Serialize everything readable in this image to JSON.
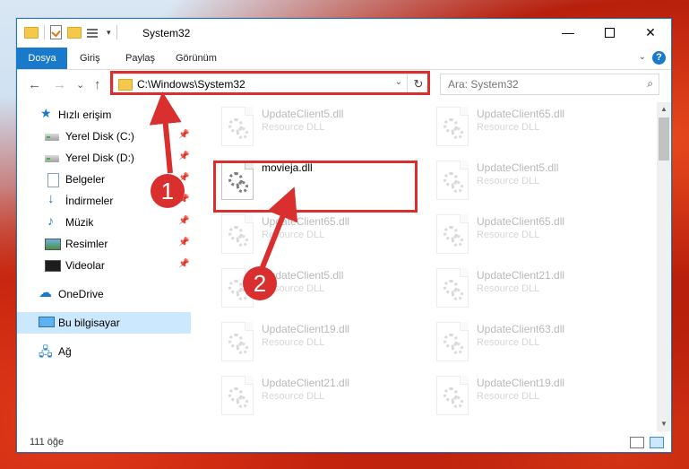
{
  "window": {
    "title": "System32",
    "controls": {
      "minimize": "—",
      "close": "✕"
    }
  },
  "ribbon": {
    "tabs": [
      "Dosya",
      "Giriş",
      "Paylaş",
      "Görünüm"
    ],
    "help": "?"
  },
  "nav": {
    "back": "←",
    "forward": "→",
    "recent": "⌄",
    "up": "↑",
    "address": "C:\\Windows\\System32",
    "refresh": "↻",
    "search_placeholder": "Ara: System32"
  },
  "sidebar": {
    "items": [
      {
        "label": "Hızlı erişim",
        "icon": "star-icon",
        "pinned": false
      },
      {
        "label": "Yerel Disk (C:)",
        "icon": "drive-icon",
        "pinned": true
      },
      {
        "label": "Yerel Disk (D:)",
        "icon": "drive-icon",
        "pinned": true
      },
      {
        "label": "Belgeler",
        "icon": "documents-icon",
        "pinned": true
      },
      {
        "label": "İndirmeler",
        "icon": "download-icon",
        "pinned": true
      },
      {
        "label": "Müzik",
        "icon": "music-icon",
        "pinned": true
      },
      {
        "label": "Resimler",
        "icon": "pictures-icon",
        "pinned": true
      },
      {
        "label": "Videolar",
        "icon": "videos-icon",
        "pinned": true
      },
      {
        "label": "OneDrive",
        "icon": "cloud-icon",
        "pinned": false
      },
      {
        "label": "Bu bilgisayar",
        "icon": "computer-icon",
        "pinned": false,
        "selected": true
      },
      {
        "label": "Ağ",
        "icon": "network-icon",
        "pinned": false
      }
    ]
  },
  "files": {
    "col1": [
      {
        "name": "UpdateClient5.dll",
        "type": "Resource DLL",
        "faded": true
      },
      {
        "name": "movieja.dll",
        "type": "",
        "faded": false,
        "highlighted": true
      },
      {
        "name": "UpdateClient65.dll",
        "type": "Resource DLL",
        "faded": true
      },
      {
        "name": "UpdateClient5.dll",
        "type": "Resource DLL",
        "faded": true
      },
      {
        "name": "UpdateClient19.dll",
        "type": "Resource DLL",
        "faded": true
      },
      {
        "name": "UpdateClient21.dll",
        "type": "Resource DLL",
        "faded": true
      }
    ],
    "col2": [
      {
        "name": "UpdateClient65.dll",
        "type": "Resource DLL",
        "faded": true
      },
      {
        "name": "UpdateClient5.dll",
        "type": "Resource DLL",
        "faded": true
      },
      {
        "name": "UpdateClient65.dll",
        "type": "Resource DLL",
        "faded": true
      },
      {
        "name": "UpdateClient21.dll",
        "type": "Resource DLL",
        "faded": true
      },
      {
        "name": "UpdateClient63.dll",
        "type": "Resource DLL",
        "faded": true
      },
      {
        "name": "UpdateClient19.dll",
        "type": "Resource DLL",
        "faded": true
      }
    ]
  },
  "status": {
    "count": "111 öğe"
  },
  "annotations": {
    "step1": "1",
    "step2": "2",
    "color": "#d9302f"
  }
}
